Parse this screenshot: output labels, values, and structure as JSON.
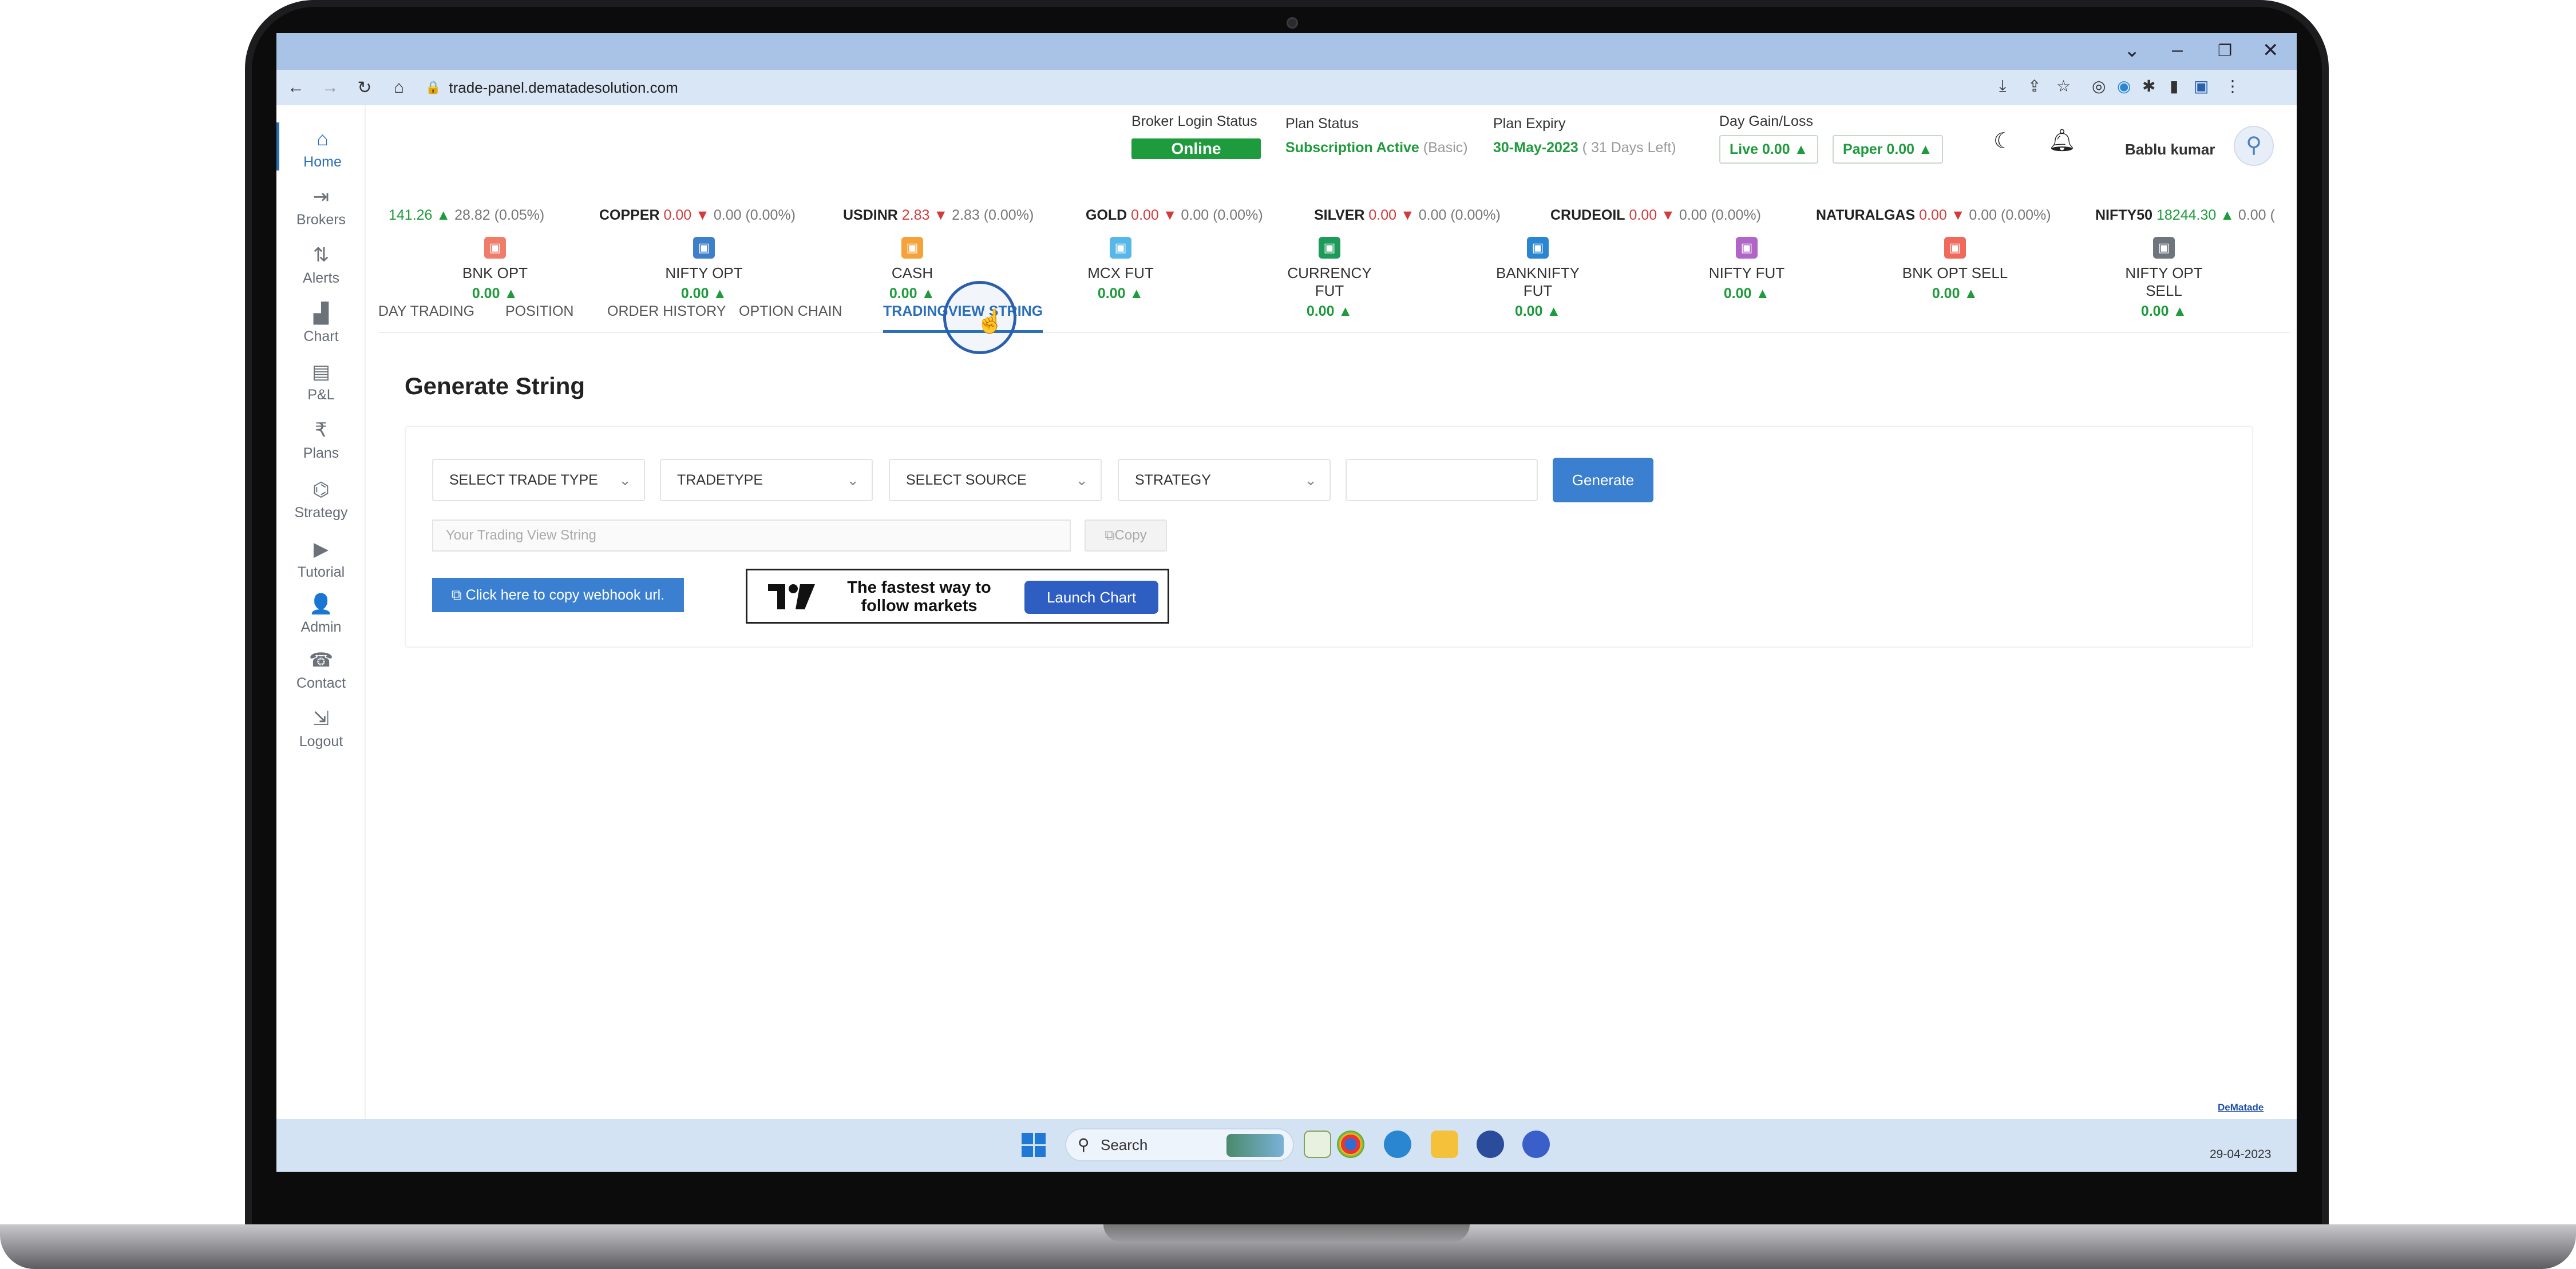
{
  "browser": {
    "url": "trade-panel.dematadesolution.com"
  },
  "sidebar": {
    "items": [
      {
        "label": "Home",
        "icon": "home-icon"
      },
      {
        "label": "Brokers",
        "icon": "login-icon"
      },
      {
        "label": "Alerts",
        "icon": "arrows-icon"
      },
      {
        "label": "Chart",
        "icon": "bar-chart-icon"
      },
      {
        "label": "P&L",
        "icon": "clipboard-icon"
      },
      {
        "label": "Plans",
        "icon": "rupee-icon"
      },
      {
        "label": "Strategy",
        "icon": "graduation-cap-icon"
      },
      {
        "label": "Tutorial",
        "icon": "play-icon"
      },
      {
        "label": "Admin",
        "icon": "user-icon"
      },
      {
        "label": "Contact",
        "icon": "phone-icon"
      },
      {
        "label": "Logout",
        "icon": "logout-icon"
      }
    ]
  },
  "header": {
    "broker_label": "Broker Login Status",
    "broker_status": "Online",
    "plan_label": "Plan Status",
    "plan_status": "Subscription Active",
    "plan_type": "(Basic)",
    "expiry_label": "Plan Expiry",
    "expiry_date": "30-May-2023",
    "expiry_left": "( 31 Days Left)",
    "gain_label": "Day Gain/Loss",
    "live": "Live  0.00",
    "paper": "Paper  0.00",
    "username": "Bablu kumar"
  },
  "ticker": [
    {
      "name": "",
      "price": "141.26",
      "dir": "up",
      "change": "28.82 (0.05%)"
    },
    {
      "name": "COPPER",
      "price": "0.00",
      "dir": "down",
      "change": "0.00 (0.00%)"
    },
    {
      "name": "USDINR",
      "price": "2.83",
      "dir": "down",
      "change": "2.83 (0.00%)"
    },
    {
      "name": "GOLD",
      "price": "0.00",
      "dir": "down",
      "change": "0.00 (0.00%)"
    },
    {
      "name": "SILVER",
      "price": "0.00",
      "dir": "down",
      "change": "0.00 (0.00%)"
    },
    {
      "name": "CRUDEOIL",
      "price": "0.00",
      "dir": "down",
      "change": "0.00 (0.00%)"
    },
    {
      "name": "NATURALGAS",
      "price": "0.00",
      "dir": "down",
      "change": "0.00 (0.00%)"
    },
    {
      "name": "NIFTY50",
      "price": "18244.30",
      "dir": "up",
      "change": "0.00 ("
    }
  ],
  "segments": [
    {
      "name": "BNK OPT",
      "value": "0.00",
      "color": "#f07c6a"
    },
    {
      "name": "NIFTY OPT",
      "value": "0.00",
      "color": "#3f7fc9"
    },
    {
      "name": "CASH",
      "value": "0.00",
      "color": "#f5a23b"
    },
    {
      "name": "MCX FUT",
      "value": "0.00",
      "color": "#56b7e8"
    },
    {
      "name": "CURRENCY FUT",
      "value": "0.00",
      "color": "#1e9b5a"
    },
    {
      "name": "BANKNIFTY FUT",
      "value": "0.00",
      "color": "#2a86d1"
    },
    {
      "name": "NIFTY FUT",
      "value": "0.00",
      "color": "#b065c7"
    },
    {
      "name": "BNK OPT SELL",
      "value": "0.00",
      "color": "#f06a5c"
    },
    {
      "name": "NIFTY OPT SELL",
      "value": "0.00",
      "color": "#6f757c"
    }
  ],
  "tabs": [
    "DAY TRADING",
    "POSITION",
    "ORDER HISTORY",
    "OPTION CHAIN",
    "TRADINGVIEW STRING"
  ],
  "generate": {
    "title": "Generate String",
    "selects": [
      "SELECT TRADE TYPE",
      "TRADETYPE",
      "SELECT SOURCE",
      "STRATEGY"
    ],
    "generate_label": "Generate",
    "string_placeholder": "Your Trading View String",
    "copy_label": "Copy",
    "webhook_label": "Click here to copy webhook url."
  },
  "tv_ad": {
    "text": "The fastest way to follow markets",
    "button": "Launch Chart"
  },
  "taskbar": {
    "search": "Search",
    "date": "29-04-2023"
  },
  "watermark": "DeMatade",
  "colors": {
    "accent": "#2a6fb8",
    "positive": "#1e9b3c",
    "negative": "#d23b3b",
    "button": "#3a7fd0"
  }
}
